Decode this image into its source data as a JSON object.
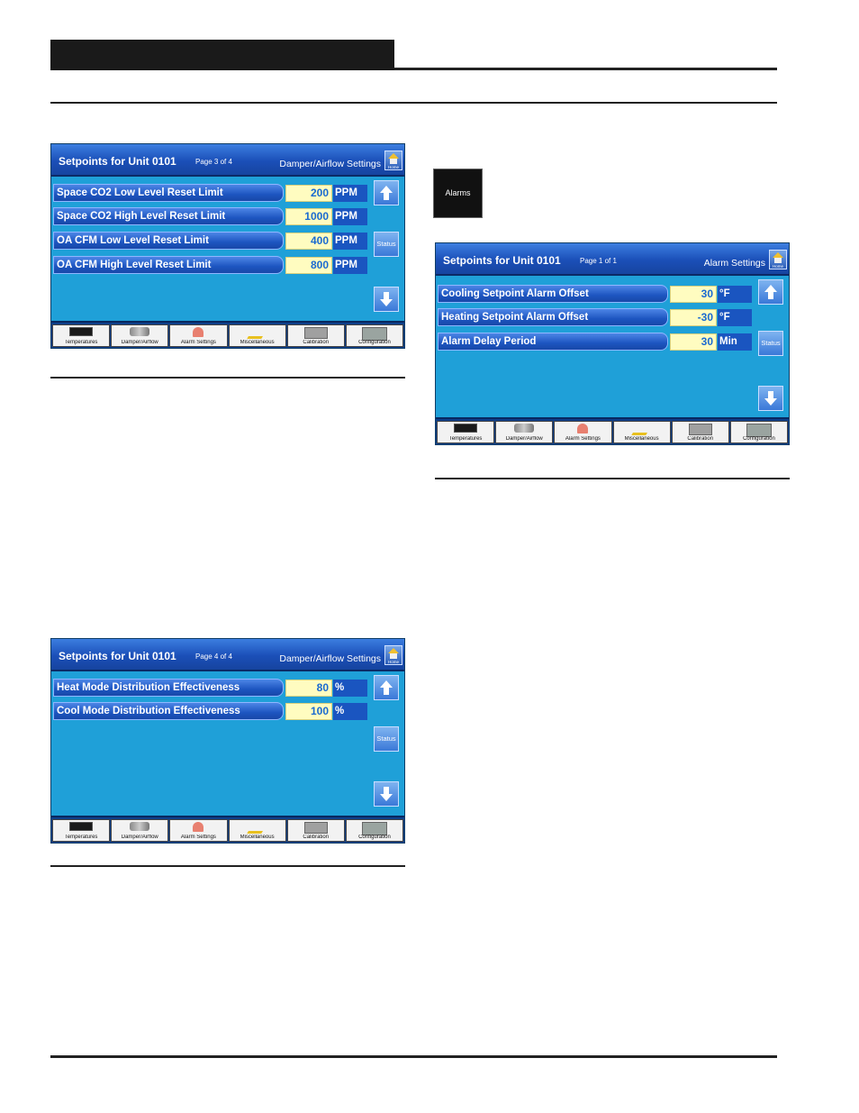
{
  "panels": [
    {
      "title": "Setpoints for Unit 0101",
      "page": "Page 3 of 4",
      "section": "Damper/Airflow Settings",
      "rows": [
        {
          "label": "Space CO2 Low Level Reset Limit",
          "value": "200",
          "unit": "PPM"
        },
        {
          "label": "Space CO2 High Level Reset Limit",
          "value": "1000",
          "unit": "PPM"
        },
        {
          "label": "OA CFM Low Level Reset Limit",
          "value": "400",
          "unit": "PPM"
        },
        {
          "label": "OA CFM High Level Reset Limit",
          "value": "800",
          "unit": "PPM"
        }
      ]
    },
    {
      "title": "Setpoints for Unit 0101",
      "page": "Page 4 of 4",
      "section": "Damper/Airflow Settings",
      "rows": [
        {
          "label": "Heat Mode Distribution Effectiveness",
          "value": "80",
          "unit": "%"
        },
        {
          "label": "Cool Mode Distribution Effectiveness",
          "value": "100",
          "unit": "%"
        }
      ]
    },
    {
      "title": "Setpoints for Unit 0101",
      "page": "Page 1 of 1",
      "section": "Alarm Settings",
      "rows": [
        {
          "label": "Cooling Setpoint Alarm Offset",
          "value": "30",
          "unit": "°F"
        },
        {
          "label": "Heating Setpoint Alarm Offset",
          "value": "-30",
          "unit": "°F"
        },
        {
          "label": "Alarm Delay Period",
          "value": "30",
          "unit": "Min"
        }
      ]
    }
  ],
  "common": {
    "home_label": "Home",
    "status_label": "Status",
    "tabs": [
      "Temperatures",
      "Damper/Airflow",
      "Alarm Settings",
      "Miscellaneous",
      "Calibration",
      "Configuration"
    ],
    "icons": [
      "display-icon",
      "damper-icon",
      "bell-icon",
      "pencil-icon",
      "calibration-icon",
      "configuration-icon"
    ]
  },
  "alarms_button": {
    "label": "Alarms"
  },
  "colors": {
    "panel_bg": "#1fa0d8",
    "title_bar": "#1b4fb8",
    "value_bg": "#fffcc0",
    "value_text": "#1a6ad0"
  }
}
